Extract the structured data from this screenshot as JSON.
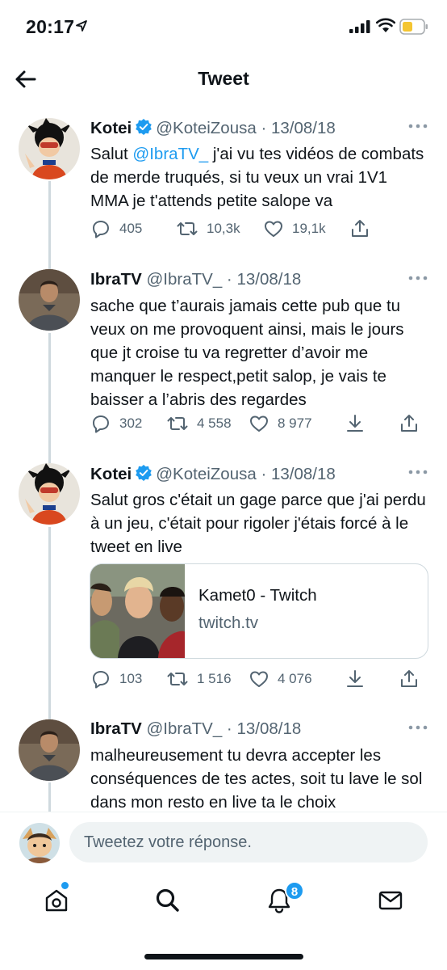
{
  "status_bar": {
    "time": "20:17",
    "icons": [
      "location-arrow-icon",
      "signal-icon",
      "wifi-icon",
      "battery-icon"
    ]
  },
  "header": {
    "title": "Tweet",
    "back_icon": "back-arrow-icon"
  },
  "tweets": [
    {
      "name": "Kotei",
      "verified": true,
      "handle": "@KoteiZousa",
      "date": "13/08/18",
      "text_before": "Salut ",
      "mention": "@IbraTV_",
      "text_after": " j'ai vu tes vidéos de combats de merde truqués, si tu veux un vrai 1V1 MMA je t'attends petite salope va",
      "replies": "405",
      "retweets": "10,3k",
      "likes": "19,1k"
    },
    {
      "name": "IbraTV",
      "verified": false,
      "handle": "@IbraTV_",
      "date": "13/08/18",
      "text": "sache que t’aurais jamais cette pub que tu veux on me provoquent ainsi, mais le jours que jt croise tu va regretter d’avoir me manquer le respect,petit salop, je vais te baisser a l’abris des regardes",
      "replies": "302",
      "retweets": "4 558",
      "likes": "8 977"
    },
    {
      "name": "Kotei",
      "verified": true,
      "handle": "@KoteiZousa",
      "date": "13/08/18",
      "text": "Salut gros c'était un gage parce que j'ai perdu à un jeu, c'était pour rigoler j'étais forcé à le tweet en live",
      "card": {
        "title": "Kamet0 - Twitch",
        "domain": "twitch.tv"
      },
      "replies": "103",
      "retweets": "1 516",
      "likes": "4 076"
    },
    {
      "name": "IbraTV",
      "verified": false,
      "handle": "@IbraTV_",
      "date": "13/08/18",
      "text": "malheureusement tu devra accepter les conséquences de tes actes, soit tu lave le sol dans mon resto en live ta le choix"
    }
  ],
  "reply_bar": {
    "placeholder": "Tweetez votre réponse."
  },
  "tab_bar": {
    "items": [
      "home-icon",
      "search-icon",
      "notifications-icon",
      "messages-icon"
    ],
    "notifications_badge": "8"
  },
  "colors": {
    "accent": "#1d9bf0",
    "text": "#0f1419",
    "secondary": "#536471",
    "border": "#cfd9de"
  }
}
